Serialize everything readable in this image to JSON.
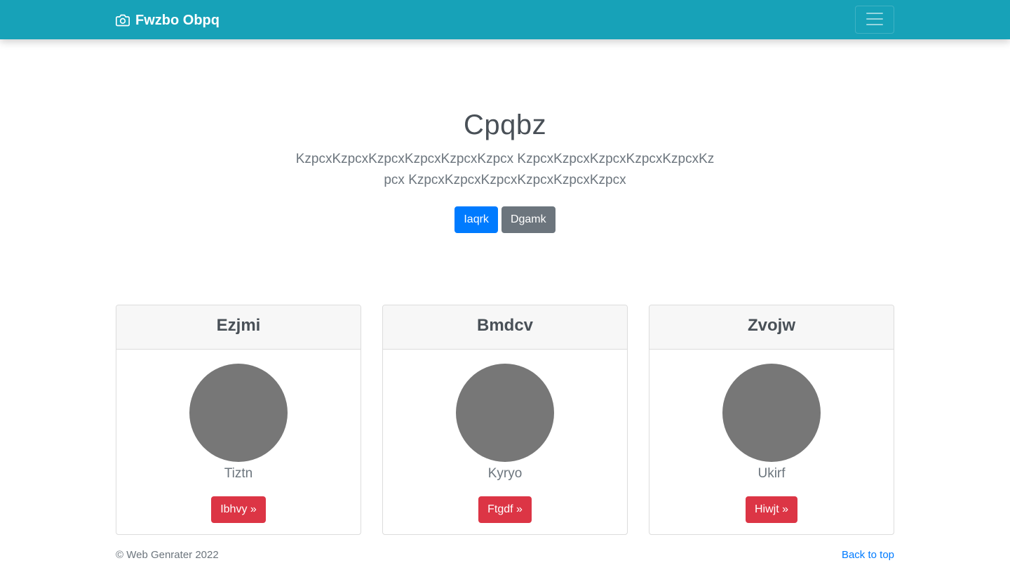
{
  "navbar": {
    "brand": "Fwzbo Obpq",
    "brand_icon": "camera-icon",
    "toggler_icon": "hamburger-menu-icon",
    "background": "#17a2b8"
  },
  "hero": {
    "title": "Cpqbz",
    "lead": "KzpcxKzpcxKzpcxKzpcxKzpcxKzpcx KzpcxKzpcxKzpcxKzpcxKzpcxKzpcx KzpcxKzpcxKzpcxKzpcxKzpcxKzpcx",
    "primary_button": "Iaqrk",
    "secondary_button": "Dgamk"
  },
  "cards": [
    {
      "header": "Ezjmi",
      "name": "Tiztn",
      "button": "Ibhvy »"
    },
    {
      "header": "Bmdcv",
      "name": "Kyryo",
      "button": "Ftgdf »"
    },
    {
      "header": "Zvojw",
      "name": "Ukirf",
      "button": "Hiwjt »"
    }
  ],
  "footer": {
    "copyright": "© Web Genrater 2022",
    "back_to_top": "Back to top"
  },
  "colors": {
    "primary": "#007bff",
    "secondary": "#6c757d",
    "danger": "#dc3545",
    "avatar": "#777777"
  }
}
